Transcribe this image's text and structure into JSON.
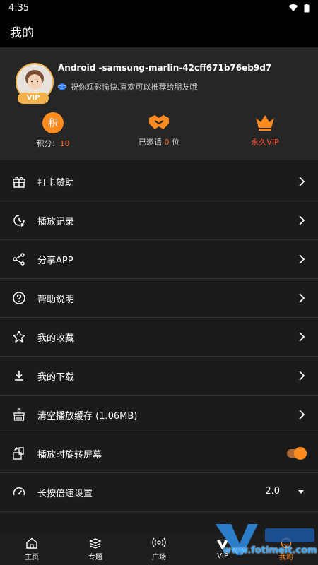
{
  "status_bar": {
    "time": "4:35"
  },
  "app_bar": {
    "title": "我的"
  },
  "profile": {
    "device_name": "Android -samsung-marlin-42cff671b76eb9d7",
    "tagline": "祝你观影愉快,喜欢可以推荐给朋友哦",
    "vip_badge": "VIP",
    "points_label": "积分：",
    "points_value": "10",
    "points_icon": "积",
    "invited_label": "已邀请",
    "invited_count": "0",
    "invited_unit": "位",
    "vip_label": "永久VIP"
  },
  "menu": [
    {
      "label": "打卡赞助"
    },
    {
      "label": "播放记录"
    },
    {
      "label": "分享APP"
    },
    {
      "label": "帮助说明"
    },
    {
      "label": "我的收藏"
    },
    {
      "label": "我的下载"
    },
    {
      "label": "清空播放缓存 (1.06MB)"
    },
    {
      "label": "播放时旋转屏幕",
      "toggle_on": true
    },
    {
      "label": "长按倍速设置",
      "value": "2.0"
    }
  ],
  "bottom_nav": [
    {
      "label": "主页"
    },
    {
      "label": "专题"
    },
    {
      "label": "广场"
    },
    {
      "label": "VIP"
    },
    {
      "label": "我的"
    }
  ],
  "watermark": {
    "text": "www.fotimeit.com"
  },
  "colors": {
    "accent": "#ff8a1e",
    "vip_red": "#ff4a2a",
    "background": "#1b1b1b",
    "card": "#262626"
  }
}
